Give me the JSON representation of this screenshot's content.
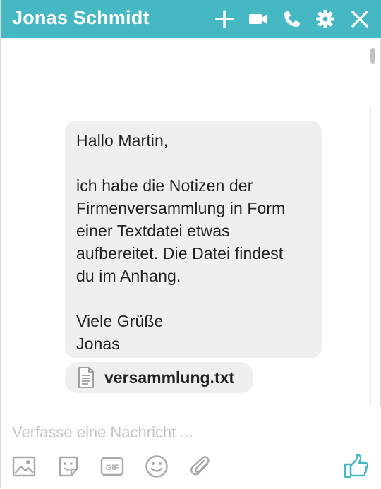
{
  "header": {
    "title": "Jonas Schmidt",
    "icons": [
      "plus-icon",
      "video-icon",
      "phone-icon",
      "gear-icon",
      "close-icon"
    ]
  },
  "message": {
    "greeting": "Hallo Martin,",
    "body_lines": [
      "ich habe die Notizen der",
      "Firmenversammlung in Form",
      "einer Textdatei etwas",
      "aufbereitet. Die Datei findest",
      "du im Anhang."
    ],
    "closing": "Viele Grüße",
    "signature": "Jonas"
  },
  "attachment": {
    "filename": "versammlung.txt",
    "icon": "text-file-icon"
  },
  "composer": {
    "placeholder": "Verfasse eine Nachricht ...",
    "tools": [
      "image-icon",
      "sticker-icon",
      "gif-icon",
      "emoji-icon",
      "paperclip-icon",
      "thumbs-up-icon"
    ]
  },
  "colors": {
    "accent": "#45b8c3",
    "bubble": "#efefef",
    "icon_gray": "#a9a9a9"
  }
}
